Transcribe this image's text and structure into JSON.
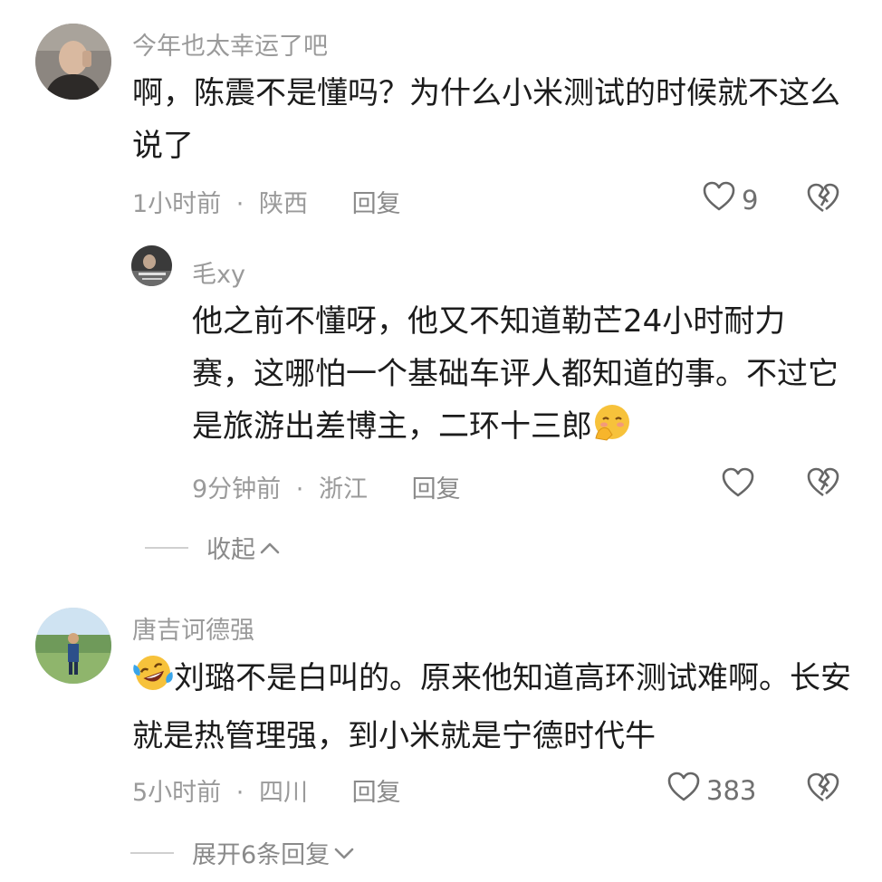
{
  "comments": [
    {
      "username": "今年也太幸运了吧",
      "text": "啊，陈震不是懂吗？为什么小米测试的时候就不这么说了",
      "time": "1小时前",
      "location": "陕西",
      "reply_label": "回复",
      "like_count": "9"
    },
    {
      "username": "唐吉诃德强",
      "text": "刘璐不是白叫的。原来他知道高环测试难啊。长安就是热管理强，到小米就是宁德时代牛",
      "time": "5小时前",
      "location": "四川",
      "reply_label": "回复",
      "like_count": "383",
      "expand_label": "展开6条回复"
    }
  ],
  "reply": {
    "username": "毛xy",
    "text": "他之前不懂呀，他又不知道勒芒24小时耐力赛，这哪怕一个基础车评人都知道的事。不过它是旅游出差博主，二环十三郎",
    "time": "9分钟前",
    "location": "浙江",
    "reply_label": "回复",
    "like_count": ""
  },
  "collapse_label": "收起",
  "separator": "·",
  "icons": {
    "like": "heart-outline-icon",
    "dislike": "broken-heart-icon",
    "collapse": "chevron-up-icon",
    "expand": "chevron-down-icon",
    "reply_emoji": "shy-face-emoji-icon",
    "comment2_emoji": "laughing-crying-face-emoji-icon"
  }
}
